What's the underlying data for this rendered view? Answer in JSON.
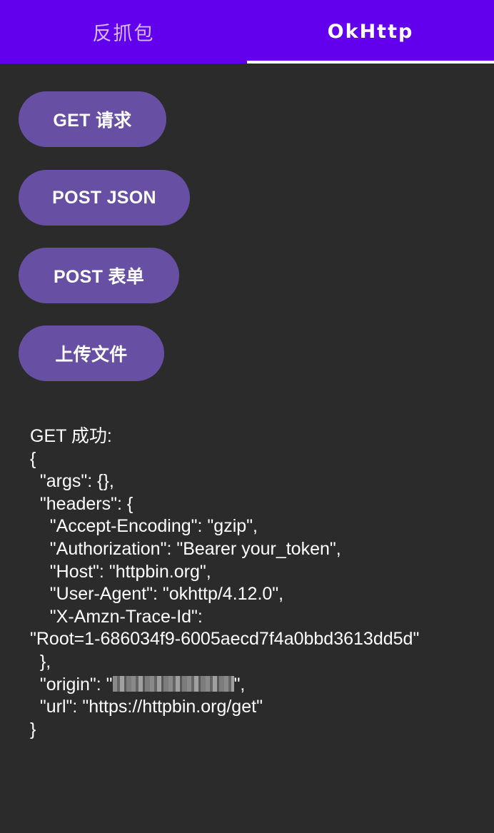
{
  "tabs": [
    {
      "label": "反抓包",
      "selected": false
    },
    {
      "label": "OkHttp",
      "selected": true
    }
  ],
  "buttons": {
    "get": "GET 请求",
    "post_json": "POST JSON",
    "post_form": "POST 表单",
    "upload": "上传文件"
  },
  "result": {
    "status": "GET 成功:",
    "lines": [
      "{",
      "  \"args\": {},",
      "  \"headers\": {",
      "    \"Accept-Encoding\": \"gzip\",",
      "    \"Authorization\": \"Bearer your_token\",",
      "    \"Host\": \"httpbin.org\",",
      "    \"User-Agent\": \"okhttp/4.12.0\",",
      "    \"X-Amzn-Trace-Id\":",
      "\"Root=1-686034f9-6005aecd7f4a0bbd3613dd5d\"",
      "  },"
    ],
    "origin_prefix": "  \"origin\": \"",
    "origin_suffix": "\",",
    "tail_lines": [
      "  \"url\": \"https://httpbin.org/get\"",
      "}"
    ]
  },
  "colors": {
    "tab_bar": "#6200ee",
    "button": "#6750a4",
    "background": "#2b2b2b",
    "text": "#ffffff"
  }
}
